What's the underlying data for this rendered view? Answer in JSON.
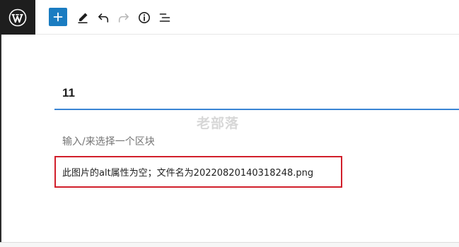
{
  "toolbar": {
    "logo_icon": "wordpress-logo-icon",
    "buttons": [
      {
        "name": "block-inserter",
        "icon": "plus-icon",
        "color": "#1a7cc1"
      },
      {
        "name": "edit-tools",
        "icon": "pencil-icon"
      },
      {
        "name": "undo",
        "icon": "undo-icon"
      },
      {
        "name": "redo",
        "icon": "redo-icon",
        "state": "disabled"
      },
      {
        "name": "details",
        "icon": "info-icon"
      },
      {
        "name": "list-view",
        "icon": "list-view-icon"
      }
    ]
  },
  "editor": {
    "title": "11",
    "block_placeholder": "输入/来选择一个区块",
    "watermark": "老部落",
    "notice": "此图片的alt属性为空；文件名为20220820140318248.png"
  },
  "colors": {
    "accent": "#3a85d4",
    "highlight": "#d11f2b",
    "logo_bg": "#1e1e1e"
  }
}
